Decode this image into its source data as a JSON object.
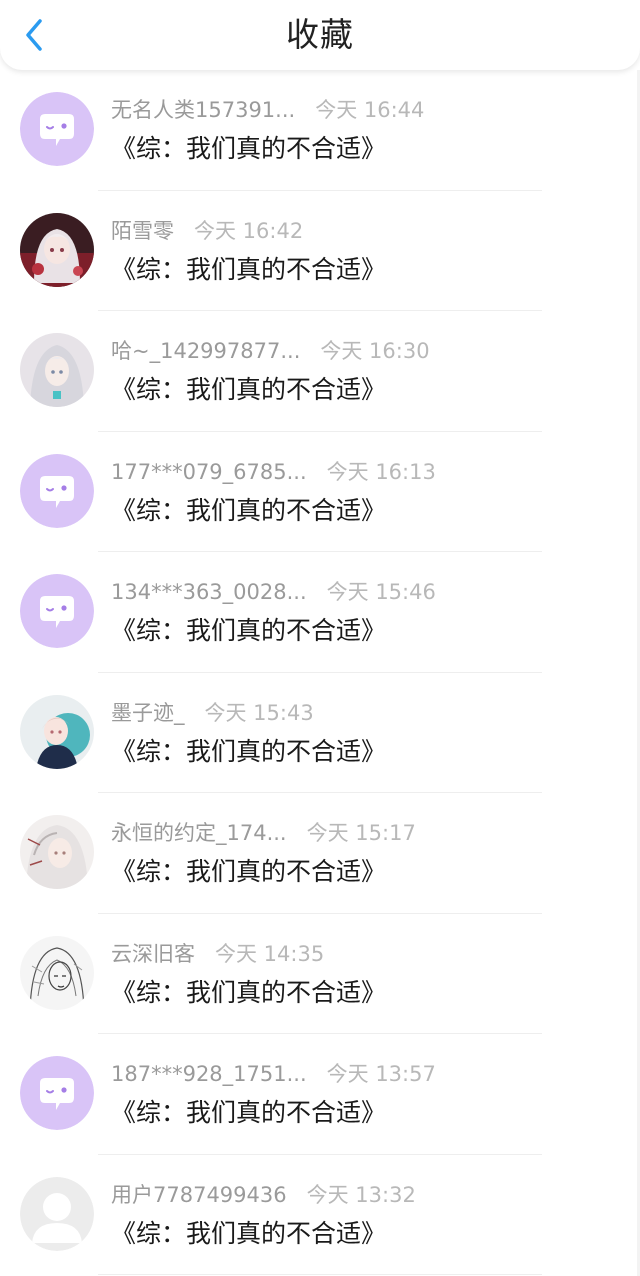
{
  "header": {
    "title": "收藏",
    "back_icon": "chevron-left-icon",
    "accent_color": "#2b9bf0"
  },
  "favorites": [
    {
      "user": "无名人类157391...",
      "time": "今天 16:44",
      "title": "《综：我们真的不合适》",
      "avatar": "default-purple-chat-avatar"
    },
    {
      "user": "陌雪零",
      "time": "今天 16:42",
      "title": "《综：我们真的不合适》",
      "avatar": "anime-girl-red-avatar"
    },
    {
      "user": "哈~_142997877...",
      "time": "今天 16:30",
      "title": "《综：我们真的不合适》",
      "avatar": "anime-silver-hair-avatar"
    },
    {
      "user": "177***079_6785...",
      "time": "今天 16:13",
      "title": "《综：我们真的不合适》",
      "avatar": "default-purple-chat-avatar"
    },
    {
      "user": "134***363_0028...",
      "time": "今天 15:46",
      "title": "《综：我们真的不合适》",
      "avatar": "default-purple-chat-avatar"
    },
    {
      "user": "墨子迹_",
      "time": "今天 15:43",
      "title": "《综：我们真的不合适》",
      "avatar": "anime-boy-teal-avatar"
    },
    {
      "user": "永恒的约定_174...",
      "time": "今天 15:17",
      "title": "《综：我们真的不合适》",
      "avatar": "anime-white-hair-avatar"
    },
    {
      "user": "云深旧客",
      "time": "今天 14:35",
      "title": "《综：我们真的不合适》",
      "avatar": "sketch-portrait-avatar"
    },
    {
      "user": "187***928_1751...",
      "time": "今天 13:57",
      "title": "《综：我们真的不合适》",
      "avatar": "default-purple-chat-avatar"
    },
    {
      "user": "用户7787499436",
      "time": "今天 13:32",
      "title": "《综：我们真的不合适》",
      "avatar": "default-gray-person-avatar"
    }
  ],
  "colors": {
    "default_avatar_bg": "#d9c4f7",
    "default_avatar_bubble": "#ffffff",
    "default_avatar_dot": "#a57ee6"
  }
}
